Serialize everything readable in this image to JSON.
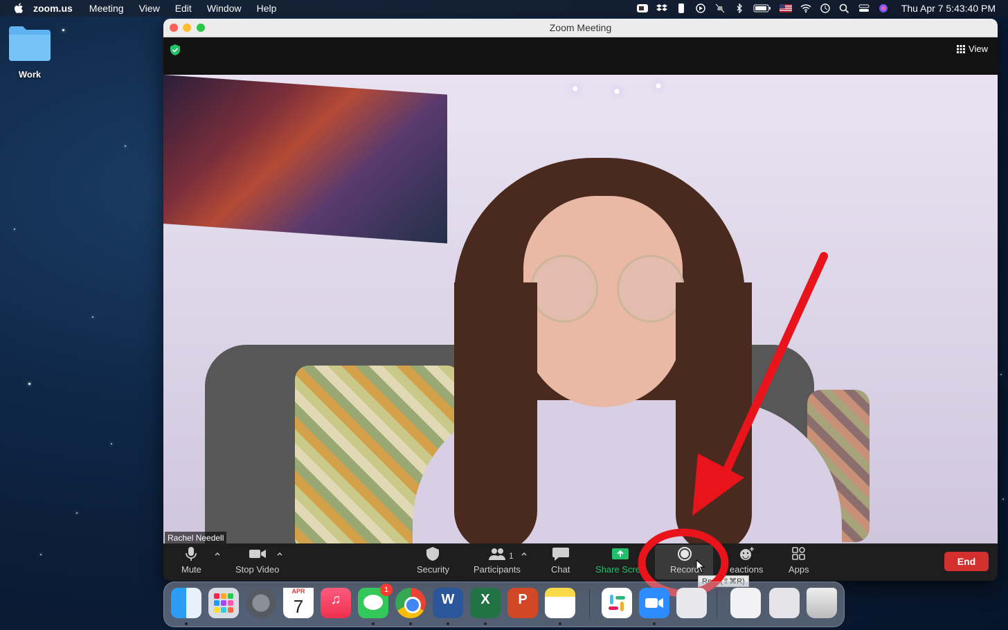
{
  "menubar": {
    "app_name": "zoom.us",
    "items": [
      "Meeting",
      "View",
      "Edit",
      "Window",
      "Help"
    ],
    "clock": "Thu Apr 7  5:43:40 PM"
  },
  "desktop": {
    "folder_label": "Work"
  },
  "window": {
    "title": "Zoom Meeting",
    "view_label": "View",
    "participant_name": "Rachel Needell"
  },
  "toolbar": {
    "mute": "Mute",
    "stop_video": "Stop Video",
    "security": "Security",
    "participants": "Participants",
    "participants_count": "1",
    "chat": "Chat",
    "share_screen": "Share Scree",
    "record": "Record",
    "reactions": "eactions",
    "apps": "Apps",
    "end": "End",
    "record_tooltip": "Re   d (⇧⌘R)"
  },
  "dock": {
    "calendar_month": "APR",
    "calendar_day": "7",
    "messages_badge": "1"
  },
  "colors": {
    "record_highlight": "#e8131b",
    "end_button": "#d32f2f",
    "share_green": "#22c06a"
  }
}
